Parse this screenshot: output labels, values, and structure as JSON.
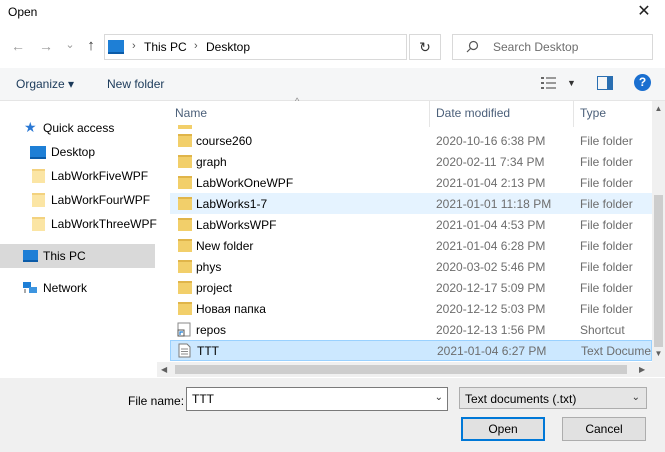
{
  "window": {
    "title": "Open",
    "close_glyph": "✕"
  },
  "nav": {
    "back_glyph": "←",
    "forward_glyph": "→",
    "recent_glyph": "⌄",
    "up_glyph": "↑",
    "breadcrumb": [
      "This PC",
      "Desktop"
    ],
    "crumb_sep": "›",
    "refresh_glyph": "↻",
    "search_placeholder": "Search Desktop"
  },
  "toolbar": {
    "organize_label": "Organize ▾",
    "new_folder_label": "New folder",
    "help_glyph": "?"
  },
  "sidebar": {
    "items": [
      {
        "label": "Quick access",
        "icon": "star-icon"
      },
      {
        "label": "Desktop",
        "icon": "desktop-icon"
      },
      {
        "label": "LabWorkFiveWPF",
        "icon": "folder-icon"
      },
      {
        "label": "LabWorkFourWPF",
        "icon": "folder-icon"
      },
      {
        "label": "LabWorkThreeWPF",
        "icon": "folder-icon"
      },
      {
        "label": "This PC",
        "icon": "pc-icon"
      },
      {
        "label": "Network",
        "icon": "network-icon"
      }
    ]
  },
  "columns": {
    "name": "Name",
    "date": "Date modified",
    "type": "Type"
  },
  "files": [
    {
      "name": "course260",
      "date": "2020-10-16 6:38 PM",
      "type": "File folder",
      "icon": "folder-icon"
    },
    {
      "name": "graph",
      "date": "2020-02-11 7:34 PM",
      "type": "File folder",
      "icon": "folder-icon"
    },
    {
      "name": "LabWorkOneWPF",
      "date": "2021-01-04 2:13 PM",
      "type": "File folder",
      "icon": "folder-icon"
    },
    {
      "name": "LabWorks1-7",
      "date": "2021-01-01 11:18 PM",
      "type": "File folder",
      "icon": "folder-icon"
    },
    {
      "name": "LabWorksWPF",
      "date": "2021-01-04 4:53 PM",
      "type": "File folder",
      "icon": "folder-icon"
    },
    {
      "name": "New folder",
      "date": "2021-01-04 6:28 PM",
      "type": "File folder",
      "icon": "folder-icon"
    },
    {
      "name": "phys",
      "date": "2020-03-02 5:46 PM",
      "type": "File folder",
      "icon": "folder-icon"
    },
    {
      "name": "project",
      "date": "2020-12-17 5:09 PM",
      "type": "File folder",
      "icon": "folder-icon"
    },
    {
      "name": "Новая папка",
      "date": "2020-12-12 5:03 PM",
      "type": "File folder",
      "icon": "folder-icon"
    },
    {
      "name": "repos",
      "date": "2020-12-13 1:56 PM",
      "type": "Shortcut",
      "icon": "shortcut-icon"
    },
    {
      "name": "TTT",
      "date": "2021-01-04 6:27 PM",
      "type": "Text Docume",
      "icon": "text-file-icon"
    }
  ],
  "footer": {
    "filename_label": "File name:",
    "filename_value": "TTT",
    "filetype_value": "Text documents (.txt)",
    "open_label": "Open",
    "cancel_label": "Cancel"
  }
}
